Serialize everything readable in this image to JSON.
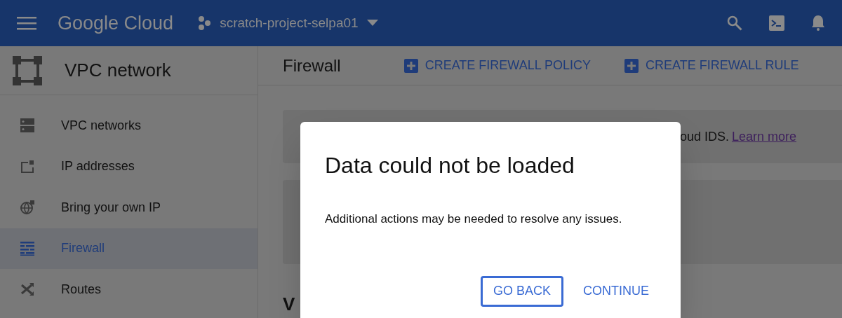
{
  "header": {
    "logo": "Google Cloud",
    "project": "scratch-project-selpa01"
  },
  "sidebar": {
    "title": "VPC network",
    "items": [
      {
        "label": "VPC networks",
        "selected": false
      },
      {
        "label": "IP addresses",
        "selected": false
      },
      {
        "label": "Bring your own IP",
        "selected": false
      },
      {
        "label": "Firewall",
        "selected": true
      },
      {
        "label": "Routes",
        "selected": false
      }
    ]
  },
  "page": {
    "title": "Firewall",
    "actions": [
      "CREATE FIREWALL POLICY",
      "CREATE FIREWALL RULE"
    ],
    "banner": {
      "text": "oud IDS.",
      "link": "Learn more"
    },
    "section_heading": "V"
  },
  "dialog": {
    "title": "Data could not be loaded",
    "message": "Additional actions may be needed to resolve any issues.",
    "buttons": [
      {
        "label": "GO BACK",
        "focused": true
      },
      {
        "label": "CONTINUE",
        "focused": false
      }
    ]
  }
}
